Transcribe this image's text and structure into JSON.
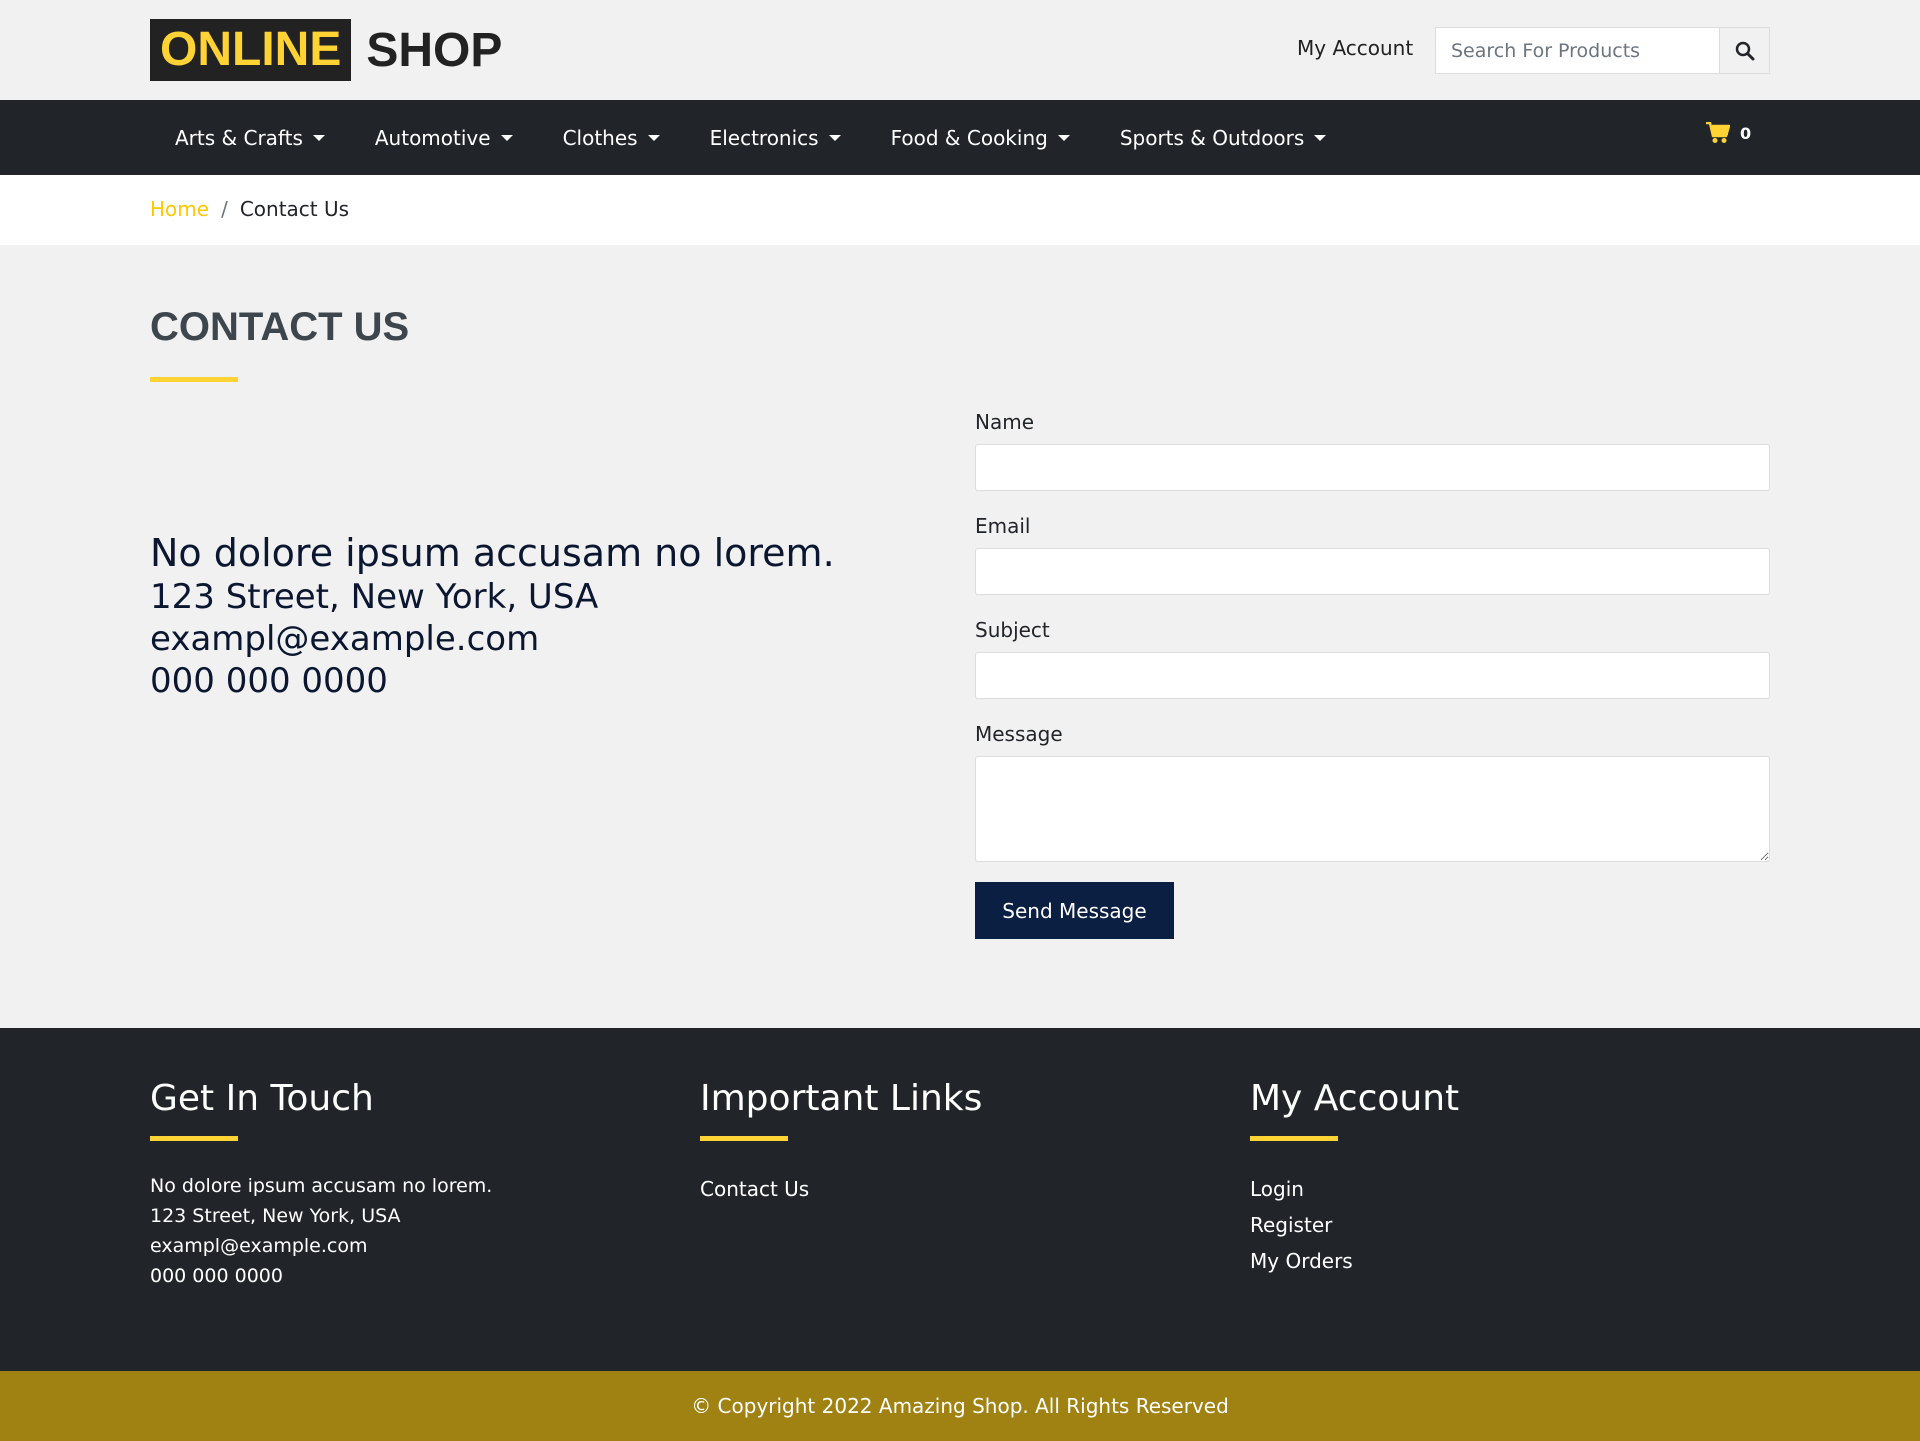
{
  "header": {
    "logo_highlight": "ONLINE",
    "logo_text": "SHOP",
    "my_account": "My Account",
    "search_placeholder": "Search For Products",
    "search_icon": "search-icon"
  },
  "nav": {
    "items": [
      {
        "label": "Arts & Crafts"
      },
      {
        "label": "Automotive"
      },
      {
        "label": "Clothes"
      },
      {
        "label": "Electronics"
      },
      {
        "label": "Food & Cooking"
      },
      {
        "label": "Sports & Outdoors"
      }
    ],
    "cart_count": "0",
    "cart_icon": "cart-icon"
  },
  "breadcrumb": {
    "home": "Home",
    "separator": "/",
    "current": "Contact Us"
  },
  "page": {
    "title": "CONTACT US"
  },
  "contact_info": {
    "tagline": "No dolore ipsum accusam no lorem.",
    "address": "123 Street, New York, USA",
    "email": "exampl@example.com",
    "phone": "000 000 0000"
  },
  "form": {
    "name_label": "Name",
    "email_label": "Email",
    "subject_label": "Subject",
    "message_label": "Message",
    "submit_label": "Send Message"
  },
  "footer": {
    "get_in_touch": {
      "heading": "Get In Touch",
      "tagline": "No dolore ipsum accusam no lorem.",
      "address": "123 Street, New York, USA",
      "email": "exampl@example.com",
      "phone": "000 000 0000"
    },
    "important_links": {
      "heading": "Important Links",
      "links": [
        {
          "label": "Contact Us"
        }
      ]
    },
    "my_account": {
      "heading": "My Account",
      "links": [
        {
          "label": "Login"
        },
        {
          "label": "Register"
        },
        {
          "label": "My Orders"
        }
      ]
    },
    "copyright": "© Copyright 2022 Amazing Shop. All Rights Reserved"
  },
  "colors": {
    "accent": "#ffd333",
    "dark": "#212529",
    "primary_button": "#0b1f43",
    "copyright_bar": "#a08213"
  }
}
